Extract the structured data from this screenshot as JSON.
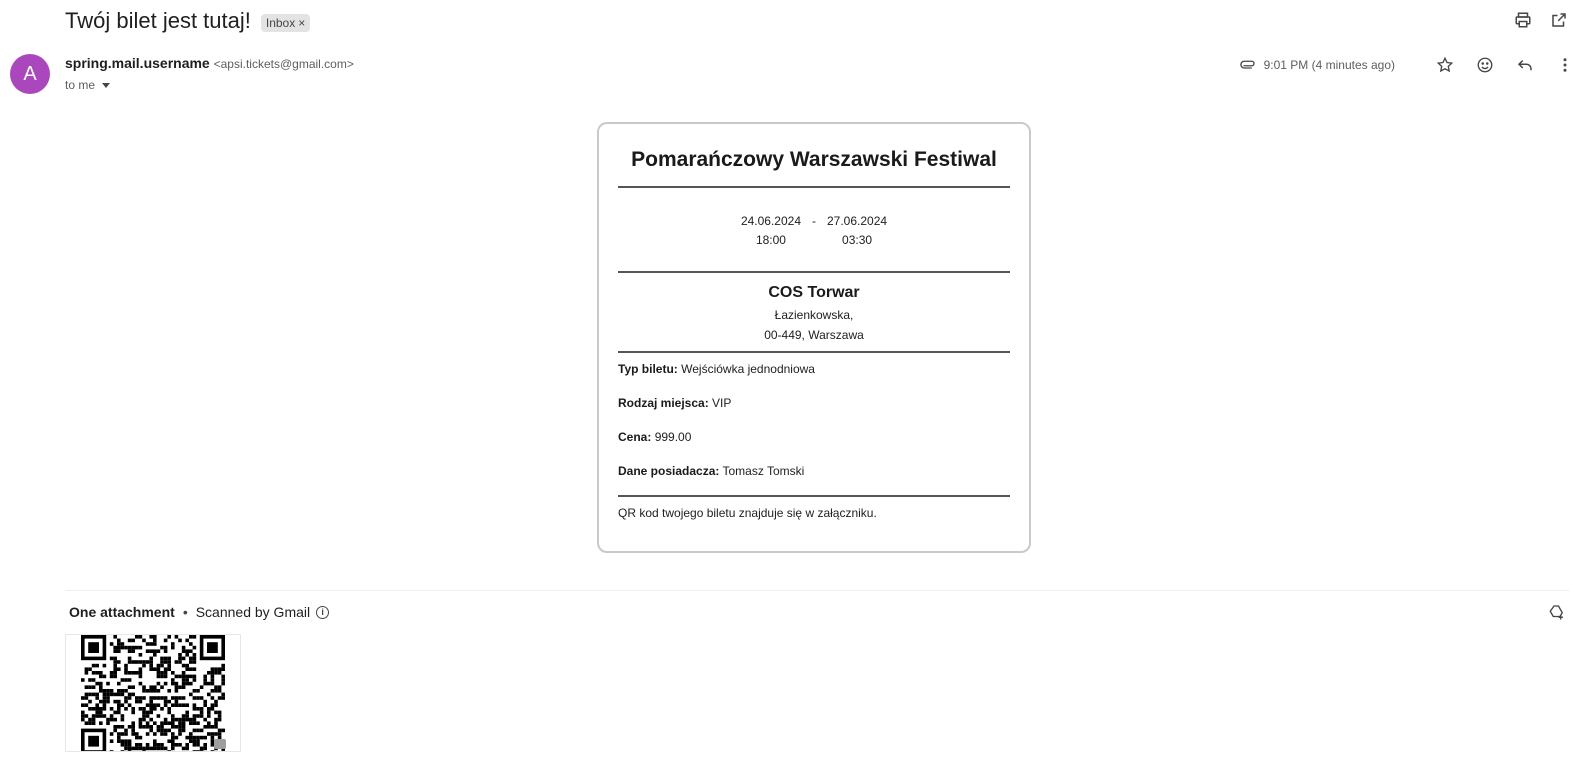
{
  "email": {
    "subject": "Twój bilet jest tutaj!",
    "label": "Inbox",
    "label_remove": "×",
    "avatar_letter": "A",
    "sender_name": "spring.mail.username",
    "sender_email": "<apsi.tickets@gmail.com>",
    "recipient": "to me",
    "time": "9:01 PM (4 minutes ago)"
  },
  "ticket": {
    "event_name": "Pomarańczowy Warszawski Festiwal",
    "start_date": "24.06.2024",
    "start_time": "18:00",
    "separator": "-",
    "end_date": "27.06.2024",
    "end_time": "03:30",
    "venue_name": "COS Torwar",
    "venue_street": "Łazienkowska,",
    "venue_city": "00-449, Warszawa",
    "fields": [
      {
        "label": "Typ biletu:",
        "value": "Wejściówka jednodniowa"
      },
      {
        "label": "Rodzaj miejsca:",
        "value": "VIP"
      },
      {
        "label": "Cena:",
        "value": "999.00"
      },
      {
        "label": "Dane posiadacza:",
        "value": "Tomasz Tomski"
      }
    ],
    "qr_note": "QR kod twojego biletu znajduje się w załączniku."
  },
  "attachments": {
    "title": "One attachment",
    "dot": "•",
    "scan_note": "Scanned by Gmail",
    "info_glyph": "i"
  },
  "icons": {
    "print": "print-icon",
    "open_new_window": "open-in-new-window-icon",
    "attachment": "paperclip-icon",
    "star": "star-icon",
    "emoji": "emoji-reaction-icon",
    "reply": "reply-icon",
    "more": "more-vertical-icon",
    "drive": "add-to-drive-icon"
  },
  "colors": {
    "avatar": "#ab47bc",
    "chip_bg": "#e3e3e3",
    "card_border": "#c9c9c9"
  }
}
